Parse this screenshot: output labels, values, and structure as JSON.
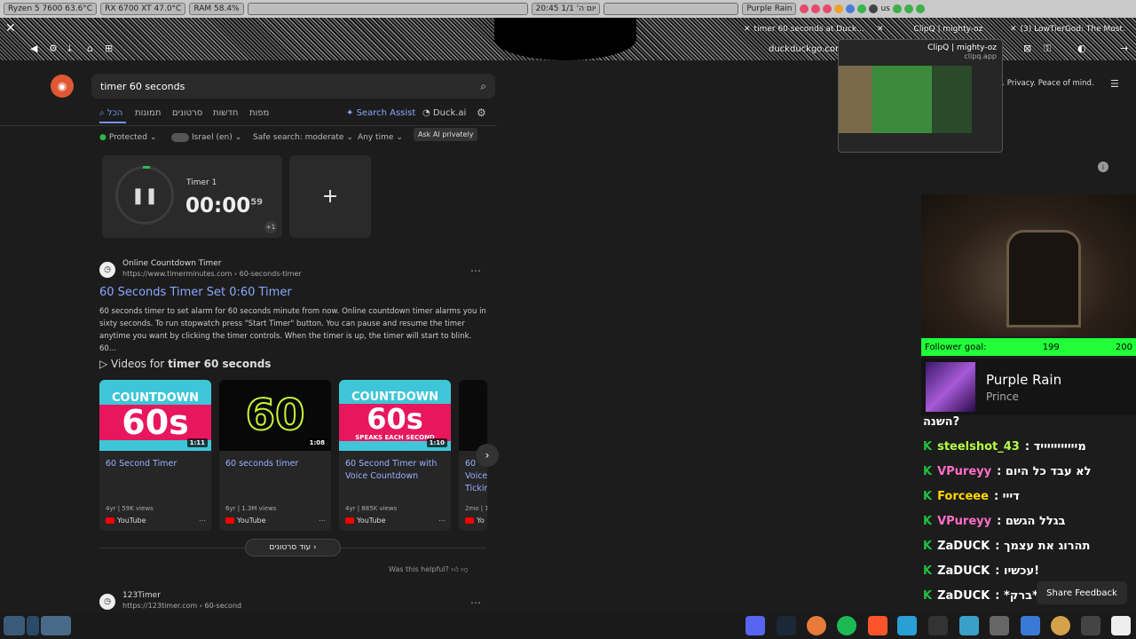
{
  "sysbar": {
    "cpu": "Ryzen 5 7600  63.6°C",
    "gpu": "RX 6700 XT  47.0°C",
    "ram": "RAM   58.4%",
    "clock": "20:45  יום ה' 1/1",
    "music": "Purple Rain",
    "lang": "us"
  },
  "tabs": {
    "tab1": "timer 60 seconds at Duck...",
    "tab2": "ClipQ | mighty-oz",
    "tab3": "(3) LowTierGod: The Most..."
  },
  "browser": {
    "url": "duckduckgo.com/"
  },
  "preview": {
    "title": "ClipQ | mighty-oz",
    "domain": "clipq.app"
  },
  "search": {
    "query": "timer 60 seconds"
  },
  "nav_tabs": [
    "הכל",
    "תמונות",
    "סרטונים",
    "חדשות",
    "מפות"
  ],
  "nav_right": {
    "assist": "Search Assist",
    "duck_ai": "Duck.ai",
    "tooltip": "Ask AI privately"
  },
  "filters": {
    "protected": "Protected",
    "region": "Israel (en)",
    "safe": "Safe search: moderate",
    "time": "Any time"
  },
  "timer": {
    "label": "Timer 1",
    "time": "00:00",
    "centis": "59",
    "plus_one": "+1",
    "add": "+"
  },
  "result1": {
    "source": "Online Countdown Timer",
    "url": "https://www.timerminutes.com › 60-seconds-timer",
    "title": "60 Seconds Timer Set 0:60 Timer",
    "snippet": "60 seconds timer to set alarm for 60 seconds minute from now. Online countdown timer alarms you in sixty seconds. To run stopwatch press \"Start Timer\" button. You can pause and resume the timer anytime you want by clicking the timer controls. When the timer is up, the timer will start to blink. 60..."
  },
  "videos": {
    "heading_prefix": "Videos for ",
    "heading_query": "timer 60 seconds",
    "items": [
      {
        "thumb_top": "COUNTDOWN",
        "thumb_big": "60s",
        "dur": "1:11",
        "title": "60 Second Timer",
        "meta": "4yr | 59K views",
        "src": "YouTube"
      },
      {
        "thumb_top": "",
        "thumb_big": "60",
        "dur": "1:08",
        "title": "60 seconds timer",
        "meta": "6yr | 1.3M views",
        "src": "YouTube"
      },
      {
        "thumb_top": "COUNTDOWN",
        "thumb_big": "60s",
        "thumb_sub": "SPEAKS EACH SECOND",
        "dur": "1:10",
        "title": "60 Second Timer with Voice Countdown",
        "meta": "4yr | 885K views",
        "src": "YouTube"
      },
      {
        "title": "60 Voice Tickin",
        "meta": "2mo | 1",
        "src": "Yo"
      }
    ],
    "more": "עוד סרטונים",
    "helpful": "Was this helpful?"
  },
  "result2": {
    "source": "123Timer",
    "url": "https://123timer.com › 60-second"
  },
  "right": {
    "privacy": "n. Privacy. Peace of mind."
  },
  "stream": {
    "follower_label": "Follower goal:",
    "follower_current": "199",
    "follower_goal": "200",
    "song": "Purple Rain",
    "artist": "Prince",
    "chat_top": "השנה?",
    "chat": [
      {
        "user": "steelshot_43",
        "color": "#b6ff44",
        "msg": ": מיייייייייייד"
      },
      {
        "user": "VPureyy",
        "color": "#ff6ec7",
        "msg": ": לא עבד כל היום"
      },
      {
        "user": "Forceee",
        "color": "#ffd700",
        "msg": ": דייי"
      },
      {
        "user": "VPureyy",
        "color": "#ff6ec7",
        "msg": ": בגלל הגשם"
      },
      {
        "user": "ZaDUCK",
        "color": "#ffffff",
        "msg": ": תהרוג את עצמך"
      },
      {
        "user": "ZaDUCK",
        "color": "#ffffff",
        "msg": ": עכשיו!"
      },
      {
        "user": "ZaDUCK",
        "color": "#ffffff",
        "msg": ": *ברק*"
      }
    ]
  },
  "share_feedback": "Share Feedback"
}
